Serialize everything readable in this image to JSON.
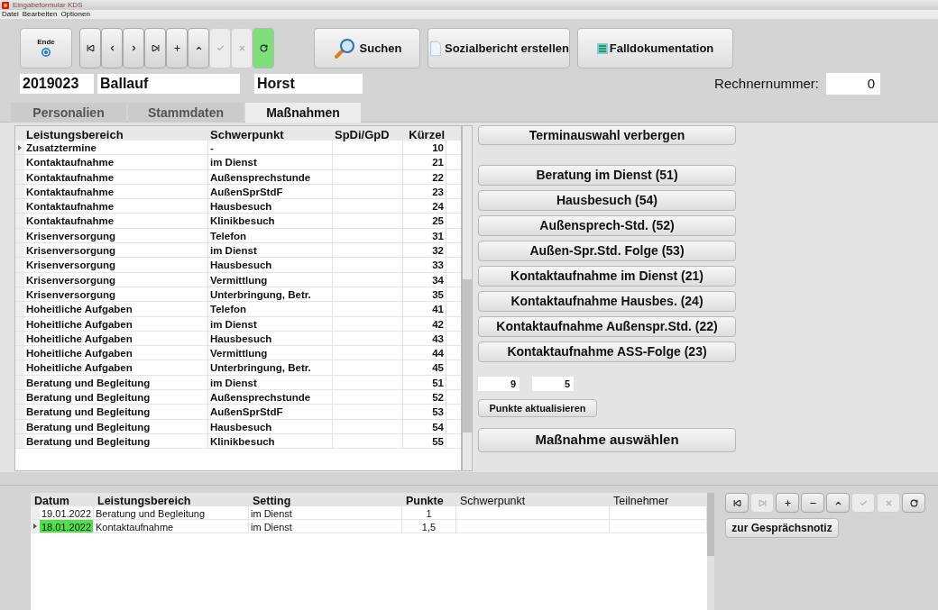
{
  "window": {
    "title": "Eingabeformular KDS"
  },
  "menu": [
    "Datei",
    "Bearbeiten",
    "Optionen"
  ],
  "toolbar": {
    "exit": {
      "label": "Ende"
    },
    "nav": [
      {
        "kind": "first",
        "disabled": false,
        "highlighted": false
      },
      {
        "kind": "prev",
        "disabled": false,
        "highlighted": false
      },
      {
        "kind": "next",
        "disabled": false,
        "highlighted": false
      },
      {
        "kind": "last",
        "disabled": false,
        "highlighted": false
      },
      {
        "kind": "add",
        "disabled": false,
        "highlighted": false
      },
      {
        "kind": "up",
        "disabled": false,
        "highlighted": false
      },
      {
        "kind": "confirm",
        "disabled": true,
        "highlighted": false
      },
      {
        "kind": "cancel",
        "disabled": true,
        "highlighted": false
      },
      {
        "kind": "refresh",
        "disabled": false,
        "highlighted": true
      }
    ],
    "search": "Suchen",
    "report": "Sozialbericht erstellen",
    "case_doc": "Falldokumentation"
  },
  "record": {
    "id": "2019023",
    "last_name": "Ballauf",
    "first_name": "Horst",
    "computer_label": "Rechnernummer:",
    "computer_number": "0"
  },
  "tabs": [
    {
      "label": "Personalien",
      "selected": false
    },
    {
      "label": "Stammdaten",
      "selected": false
    },
    {
      "label": "Maßnahmen",
      "selected": true
    }
  ],
  "measures_table": {
    "columns": [
      "Leistungsbereich",
      "Schwerpunkt",
      "SpDi/GpD",
      "Kürzel"
    ],
    "rows": [
      {
        "cells": [
          "Zusatztermine",
          "-",
          "",
          "10"
        ],
        "current": true
      },
      {
        "cells": [
          "Kontaktaufnahme",
          "im Dienst",
          "",
          "21"
        ],
        "current": false
      },
      {
        "cells": [
          "Kontaktaufnahme",
          "Außensprechstunde",
          "",
          "22"
        ],
        "current": false
      },
      {
        "cells": [
          "Kontaktaufnahme",
          "AußenSprStdF",
          "",
          "23"
        ],
        "current": false
      },
      {
        "cells": [
          "Kontaktaufnahme",
          "Hausbesuch",
          "",
          "24"
        ],
        "current": false
      },
      {
        "cells": [
          "Kontaktaufnahme",
          "Klinikbesuch",
          "",
          "25"
        ],
        "current": false
      },
      {
        "cells": [
          "Krisenversorgung",
          "Telefon",
          "",
          "31"
        ],
        "current": false
      },
      {
        "cells": [
          "Krisenversorgung",
          "im Dienst",
          "",
          "32"
        ],
        "current": false
      },
      {
        "cells": [
          "Krisenversorgung",
          "Hausbesuch",
          "",
          "33"
        ],
        "current": false
      },
      {
        "cells": [
          "Krisenversorgung",
          "Vermittlung",
          "",
          "34"
        ],
        "current": false
      },
      {
        "cells": [
          "Krisenversorgung",
          "Unterbringung, Betr.",
          "",
          "35"
        ],
        "current": false
      },
      {
        "cells": [
          "Hoheitliche Aufgaben",
          "Telefon",
          "",
          "41"
        ],
        "current": false
      },
      {
        "cells": [
          "Hoheitliche Aufgaben",
          "im Dienst",
          "",
          "42"
        ],
        "current": false
      },
      {
        "cells": [
          "Hoheitliche Aufgaben",
          "Hausbesuch",
          "",
          "43"
        ],
        "current": false
      },
      {
        "cells": [
          "Hoheitliche Aufgaben",
          "Vermittlung",
          "",
          "44"
        ],
        "current": false
      },
      {
        "cells": [
          "Hoheitliche Aufgaben",
          "Unterbringung, Betr.",
          "",
          "45"
        ],
        "current": false
      },
      {
        "cells": [
          "Beratung und Begleitung",
          "im Dienst",
          "",
          "51"
        ],
        "current": false
      },
      {
        "cells": [
          "Beratung und Begleitung",
          "Außensprechstunde",
          "",
          "52"
        ],
        "current": false
      },
      {
        "cells": [
          "Beratung und Begleitung",
          "AußenSprStdF",
          "",
          "53"
        ],
        "current": false
      },
      {
        "cells": [
          "Beratung und Begleitung",
          "Hausbesuch",
          "",
          "54"
        ],
        "current": false
      },
      {
        "cells": [
          "Beratung und Begleitung",
          "Klinikbesuch",
          "",
          "55"
        ],
        "current": false
      }
    ]
  },
  "toggle_button": "Terminauswahl verbergen",
  "quick_buttons": [
    "Beratung im Dienst (51)",
    "Hausbesuch (54)",
    "Außensprech-Std. (52)",
    "Außen-Spr.Std. Folge (53)",
    "Kontaktaufnahme im Dienst (21)",
    "Kontaktaufnahme Hausbes. (24)",
    "Kontaktaufnahme Außenspr.Std. (22)",
    "Kontaktaufnahme ASS-Folge (23)"
  ],
  "points": [
    "9",
    "5"
  ],
  "update_button": "Punkte aktualisieren",
  "select_button": "Maßnahme auswählen",
  "entries_table": {
    "columns": [
      "Datum",
      "Leistungsbereich",
      "Setting",
      "Punkte",
      "Schwerpunkt",
      "Teilnehmer"
    ],
    "rows": [
      {
        "cells": [
          "19.01.2022",
          "Beratung und Begleitung",
          "im Dienst",
          "1",
          "",
          ""
        ],
        "selected": false
      },
      {
        "cells": [
          "18.01.2022",
          "Kontaktaufnahme",
          "im Dienst",
          "1,5",
          "",
          ""
        ],
        "selected": true
      }
    ]
  },
  "entries_nav": [
    {
      "kind": "first",
      "disabled": false
    },
    {
      "kind": "last",
      "disabled": true
    },
    {
      "kind": "add",
      "disabled": false
    },
    {
      "kind": "remove",
      "disabled": false
    },
    {
      "kind": "up",
      "disabled": false
    },
    {
      "kind": "confirm",
      "disabled": true
    },
    {
      "kind": "cancel",
      "disabled": true
    },
    {
      "kind": "refresh",
      "disabled": false
    }
  ],
  "note_button": "zur Gesprächsnotiz"
}
